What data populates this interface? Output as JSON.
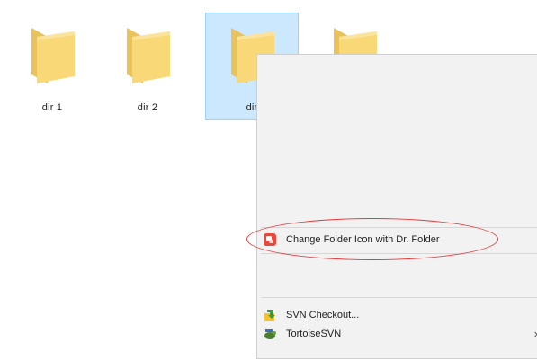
{
  "folders": [
    {
      "label": "dir 1"
    },
    {
      "label": "dir 2"
    },
    {
      "label": "dir"
    },
    {
      "label": ""
    }
  ],
  "context_menu": {
    "items": [
      {
        "label": "Change Folder Icon with Dr. Folder",
        "icon": "dr-folder-icon"
      },
      {
        "label": "SVN Checkout...",
        "icon": "svn-checkout-icon"
      },
      {
        "label": "TortoiseSVN",
        "icon": "tortoisesvn-icon",
        "submenu_arrow": "›"
      }
    ]
  },
  "colors": {
    "folder_yellow": "#f8d877",
    "selection_bg": "#cce8ff",
    "highlight_ring": "#e23b3b"
  }
}
